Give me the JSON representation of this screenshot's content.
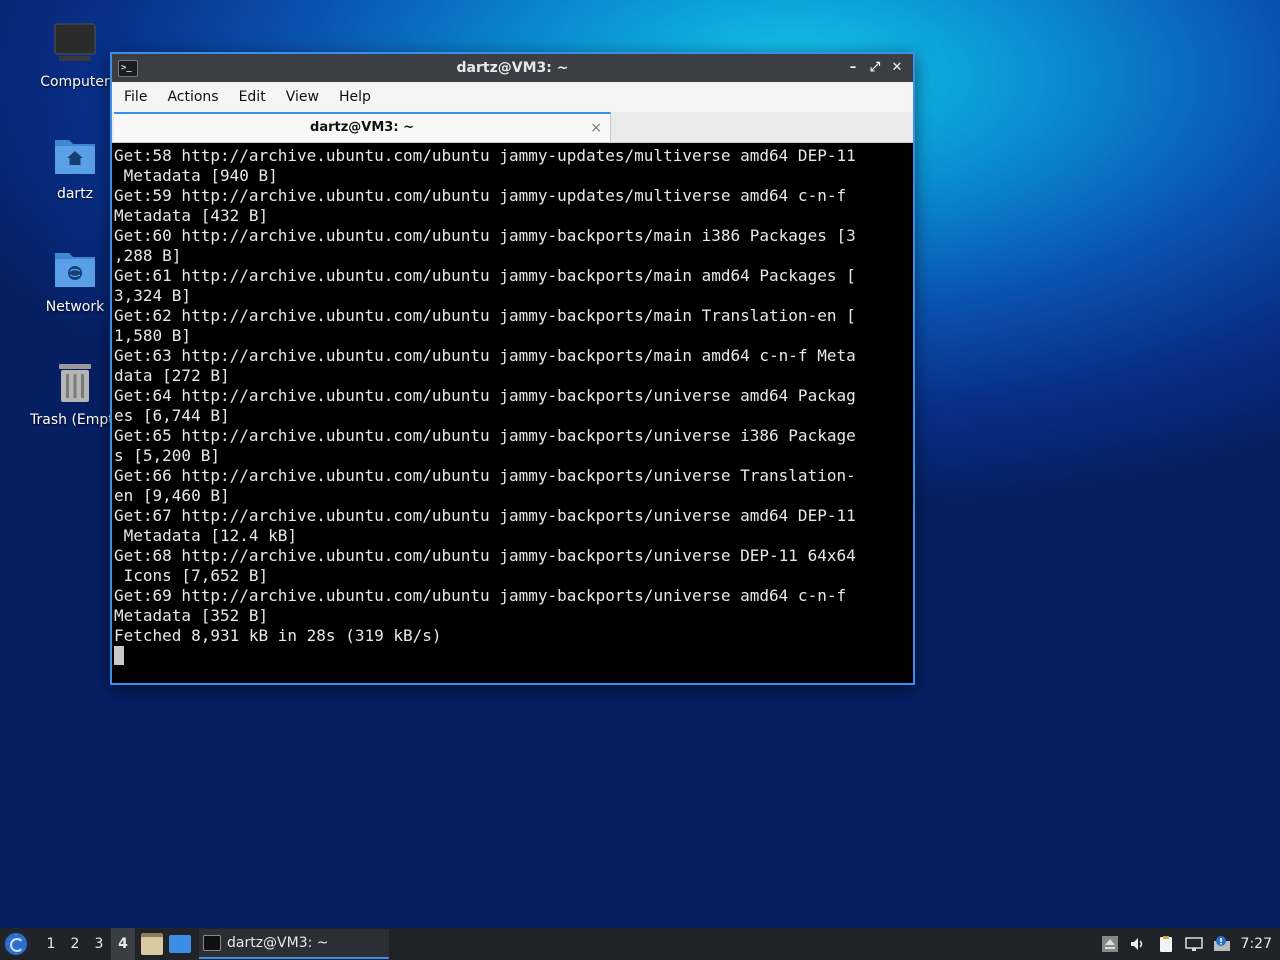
{
  "desktop": {
    "icons": [
      {
        "label": "Computer"
      },
      {
        "label": "dartz"
      },
      {
        "label": "Network"
      },
      {
        "label": "Trash (Empty)"
      }
    ]
  },
  "window": {
    "title": "dartz@VM3: ~",
    "menu": [
      "File",
      "Actions",
      "Edit",
      "View",
      "Help"
    ],
    "tab_label": "dartz@VM3: ~",
    "tab_close": "×",
    "controls": {
      "minimize": "–",
      "maximize": "⤢",
      "close": "✕"
    }
  },
  "terminal": {
    "lines": [
      "Get:58 http://archive.ubuntu.com/ubuntu jammy-updates/multiverse amd64 DEP-11",
      " Metadata [940 B]",
      "Get:59 http://archive.ubuntu.com/ubuntu jammy-updates/multiverse amd64 c-n-f",
      "Metadata [432 B]",
      "Get:60 http://archive.ubuntu.com/ubuntu jammy-backports/main i386 Packages [3",
      ",288 B]",
      "Get:61 http://archive.ubuntu.com/ubuntu jammy-backports/main amd64 Packages [",
      "3,324 B]",
      "Get:62 http://archive.ubuntu.com/ubuntu jammy-backports/main Translation-en [",
      "1,580 B]",
      "Get:63 http://archive.ubuntu.com/ubuntu jammy-backports/main amd64 c-n-f Meta",
      "data [272 B]",
      "Get:64 http://archive.ubuntu.com/ubuntu jammy-backports/universe amd64 Packag",
      "es [6,744 B]",
      "Get:65 http://archive.ubuntu.com/ubuntu jammy-backports/universe i386 Package",
      "s [5,200 B]",
      "Get:66 http://archive.ubuntu.com/ubuntu jammy-backports/universe Translation-",
      "en [9,460 B]",
      "Get:67 http://archive.ubuntu.com/ubuntu jammy-backports/universe amd64 DEP-11",
      " Metadata [12.4 kB]",
      "Get:68 http://archive.ubuntu.com/ubuntu jammy-backports/universe DEP-11 64x64",
      " Icons [7,652 B]",
      "Get:69 http://archive.ubuntu.com/ubuntu jammy-backports/universe amd64 c-n-f",
      "Metadata [352 B]",
      "Fetched 8,931 kB in 28s (319 kB/s)"
    ]
  },
  "taskbar": {
    "workspaces": [
      "1",
      "2",
      "3",
      "4"
    ],
    "active_workspace": "4",
    "task_label": "dartz@VM3: ~",
    "clock": "7:27"
  },
  "colors": {
    "accent": "#3a8ee6",
    "titlebar": "#3b3f45",
    "taskbar": "#202328",
    "terminal_bg": "#000000",
    "terminal_fg": "#e8e8e8"
  }
}
